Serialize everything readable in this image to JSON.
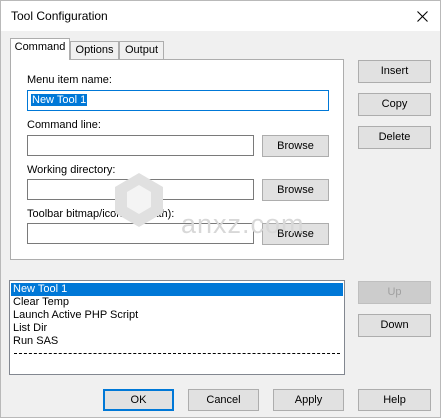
{
  "window": {
    "title": "Tool Configuration"
  },
  "tabs": [
    {
      "label": "Command",
      "active": true
    },
    {
      "label": "Options",
      "active": false
    },
    {
      "label": "Output",
      "active": false
    }
  ],
  "command": {
    "menu_item_label": "Menu item name:",
    "menu_item_value": "New Tool 1",
    "command_line_label": "Command line:",
    "command_line_value": "",
    "working_dir_label": "Working directory:",
    "working_dir_value": "",
    "toolbar_bitmap_label": "Toolbar bitmap/icon (file path):",
    "toolbar_bitmap_value": "",
    "browse_label": "Browse"
  },
  "side_buttons": {
    "insert": "Insert",
    "copy": "Copy",
    "delete": "Delete",
    "up": "Up",
    "down": "Down"
  },
  "tools_list": {
    "items": [
      "New Tool 1",
      "Clear Temp",
      "Launch Active PHP Script",
      "List Dir",
      "Run SAS"
    ],
    "selected": "New Tool 1"
  },
  "footer_buttons": {
    "ok": "OK",
    "cancel": "Cancel",
    "apply": "Apply",
    "help": "Help"
  },
  "watermark": {
    "text": "anxz.com"
  }
}
